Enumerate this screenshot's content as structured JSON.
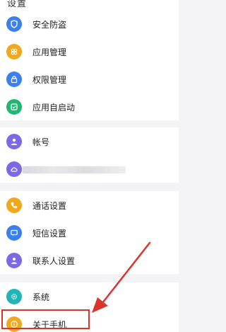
{
  "header": {
    "title": "设置"
  },
  "groups": [
    {
      "items": [
        {
          "label": "安全防盗",
          "color": "#3b7ff0",
          "icon": "shield-icon"
        },
        {
          "label": "应用管理",
          "color": "#f2a81d",
          "icon": "apps-icon"
        },
        {
          "label": "权限管理",
          "color": "#3b7ff0",
          "icon": "lock-icon"
        },
        {
          "label": "应用自启动",
          "color": "#22b573",
          "icon": "autostart-icon"
        }
      ]
    },
    {
      "items": [
        {
          "label": "帐号",
          "color": "#7b69e8",
          "icon": "user-icon"
        },
        {
          "label": "",
          "color": "#7b69e8",
          "icon": "cloud-icon",
          "blurred": true
        }
      ]
    },
    {
      "items": [
        {
          "label": "通话设置",
          "color": "#f2a81d",
          "icon": "phone-icon"
        },
        {
          "label": "短信设置",
          "color": "#3b7ff0",
          "icon": "message-icon"
        },
        {
          "label": "联系人设置",
          "color": "#7b69e8",
          "icon": "contacts-icon"
        }
      ]
    },
    {
      "items": [
        {
          "label": "系统",
          "color": "#22b5b5",
          "icon": "gear-icon"
        },
        {
          "label": "关于手机",
          "color": "#f2a81d",
          "icon": "info-icon"
        }
      ]
    }
  ],
  "annotation": {
    "color": "#d9352b"
  }
}
